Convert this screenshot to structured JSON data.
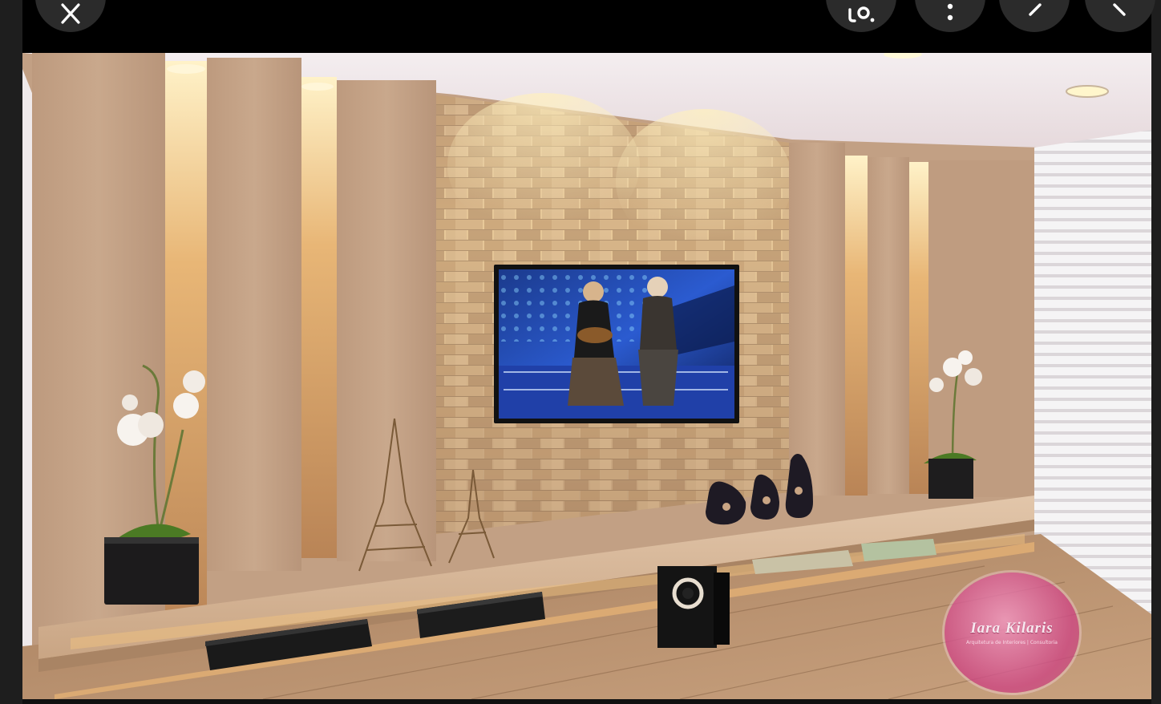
{
  "viewer": {
    "controls": {
      "close_icon": "close-icon",
      "lens_icon": "lens-search-icon",
      "more_icon": "more-vertical-icon",
      "prev_icon": "chevron-left-icon",
      "next_icon": "chevron-right-icon"
    },
    "colors": {
      "topbar": "#000000",
      "button_bg": "#2b2b2b",
      "icon": "#ffffff",
      "gutter": "#1e1e1e"
    }
  },
  "image": {
    "watermark": {
      "name": "Iara Kilaris",
      "subtitle": "Arquitetura de Interiores | Consultoria"
    }
  }
}
